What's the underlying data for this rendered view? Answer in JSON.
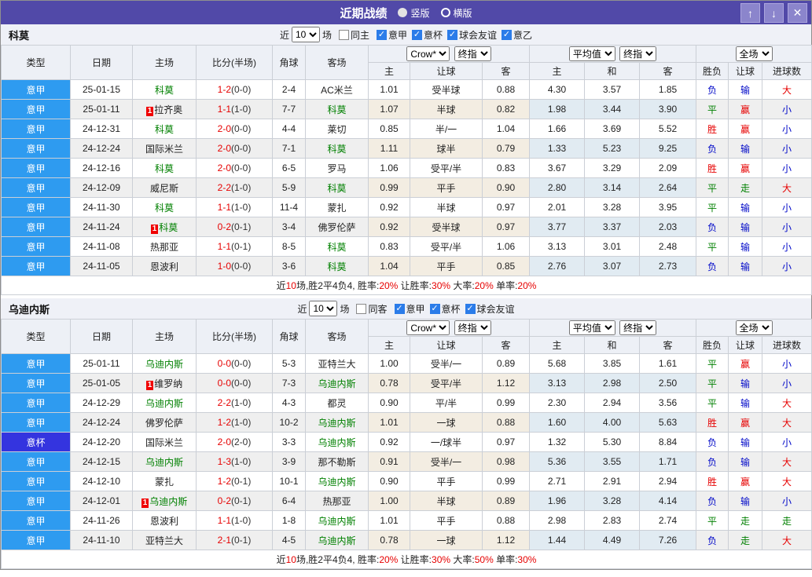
{
  "titlebar": {
    "title": "近期战绩",
    "vertical": "竖版",
    "horizontal": "横版",
    "buttons": {
      "up": "↑",
      "down": "↓",
      "close": "✕"
    }
  },
  "colors": {
    "titlebar_purple": "#5149A8",
    "league_blue": "#2E9BF0",
    "cup_blue": "#3434DF",
    "win_red": "#E60000",
    "draw_green": "#008000",
    "lose_blue": "#0008C8",
    "checkbox_blue": "#2B7CE9"
  },
  "cols": {
    "type": "类型",
    "date": "日期",
    "home": "主场",
    "score": "比分(半场)",
    "corner": "角球",
    "away": "客场",
    "h": "主",
    "hand": "让球",
    "a": "客",
    "draw": "和",
    "wl": "胜负",
    "goals": "进球数"
  },
  "selects": {
    "crow": "Crow*",
    "final": "终指",
    "avg": "平均值",
    "full": "全场"
  },
  "sections": [
    {
      "team": "科莫",
      "filter": {
        "near": "近",
        "count": "10",
        "games": "场",
        "same": "同主",
        "same_checked": false,
        "leagues": [
          [
            "意甲",
            true
          ],
          [
            "意杯",
            true
          ],
          [
            "球会友谊",
            true
          ],
          [
            "意乙",
            true
          ]
        ]
      },
      "rows": [
        {
          "lg": "意甲",
          "cup": false,
          "date": "25-01-15",
          "home": "科莫",
          "hg": true,
          "hb": false,
          "score": "1-2",
          "half": "(0-0)",
          "corner": "2-4",
          "away": "AC米兰",
          "ag": false,
          "ab": false,
          "crow": [
            "1.01",
            "受半球",
            "0.88"
          ],
          "avg": [
            "4.30",
            "3.57",
            "1.85"
          ],
          "res": [
            [
              "负",
              "b"
            ],
            [
              "输",
              "b"
            ],
            [
              "大",
              "r"
            ]
          ]
        },
        {
          "lg": "意甲",
          "cup": false,
          "date": "25-01-11",
          "home": "拉齐奥",
          "hg": false,
          "hb": true,
          "score": "1-1",
          "half": "(1-0)",
          "corner": "7-7",
          "away": "科莫",
          "ag": true,
          "ab": false,
          "crow": [
            "1.07",
            "半球",
            "0.82"
          ],
          "avg": [
            "1.98",
            "3.44",
            "3.90"
          ],
          "res": [
            [
              "平",
              "g"
            ],
            [
              "赢",
              "r"
            ],
            [
              "小",
              "b"
            ]
          ]
        },
        {
          "lg": "意甲",
          "cup": false,
          "date": "24-12-31",
          "home": "科莫",
          "hg": true,
          "hb": false,
          "score": "2-0",
          "half": "(0-0)",
          "corner": "4-4",
          "away": "莱切",
          "ag": false,
          "ab": false,
          "crow": [
            "0.85",
            "半/一",
            "1.04"
          ],
          "avg": [
            "1.66",
            "3.69",
            "5.52"
          ],
          "res": [
            [
              "胜",
              "r"
            ],
            [
              "赢",
              "r"
            ],
            [
              "小",
              "b"
            ]
          ]
        },
        {
          "lg": "意甲",
          "cup": false,
          "date": "24-12-24",
          "home": "国际米兰",
          "hg": false,
          "hb": false,
          "score": "2-0",
          "half": "(0-0)",
          "corner": "7-1",
          "away": "科莫",
          "ag": true,
          "ab": false,
          "crow": [
            "1.11",
            "球半",
            "0.79"
          ],
          "avg": [
            "1.33",
            "5.23",
            "9.25"
          ],
          "res": [
            [
              "负",
              "b"
            ],
            [
              "输",
              "b"
            ],
            [
              "小",
              "b"
            ]
          ]
        },
        {
          "lg": "意甲",
          "cup": false,
          "date": "24-12-16",
          "home": "科莫",
          "hg": true,
          "hb": false,
          "score": "2-0",
          "half": "(0-0)",
          "corner": "6-5",
          "away": "罗马",
          "ag": false,
          "ab": false,
          "crow": [
            "1.06",
            "受平/半",
            "0.83"
          ],
          "avg": [
            "3.67",
            "3.29",
            "2.09"
          ],
          "res": [
            [
              "胜",
              "r"
            ],
            [
              "赢",
              "r"
            ],
            [
              "小",
              "b"
            ]
          ]
        },
        {
          "lg": "意甲",
          "cup": false,
          "date": "24-12-09",
          "home": "威尼斯",
          "hg": false,
          "hb": false,
          "score": "2-2",
          "half": "(1-0)",
          "corner": "5-9",
          "away": "科莫",
          "ag": true,
          "ab": false,
          "crow": [
            "0.99",
            "平手",
            "0.90"
          ],
          "avg": [
            "2.80",
            "3.14",
            "2.64"
          ],
          "res": [
            [
              "平",
              "g"
            ],
            [
              "走",
              "g"
            ],
            [
              "大",
              "r"
            ]
          ]
        },
        {
          "lg": "意甲",
          "cup": false,
          "date": "24-11-30",
          "home": "科莫",
          "hg": true,
          "hb": false,
          "score": "1-1",
          "half": "(1-0)",
          "corner": "11-4",
          "away": "蒙扎",
          "ag": false,
          "ab": false,
          "crow": [
            "0.92",
            "半球",
            "0.97"
          ],
          "avg": [
            "2.01",
            "3.28",
            "3.95"
          ],
          "res": [
            [
              "平",
              "g"
            ],
            [
              "输",
              "b"
            ],
            [
              "小",
              "b"
            ]
          ]
        },
        {
          "lg": "意甲",
          "cup": false,
          "date": "24-11-24",
          "home": "科莫",
          "hg": true,
          "hb": true,
          "score": "0-2",
          "half": "(0-1)",
          "corner": "3-4",
          "away": "佛罗伦萨",
          "ag": false,
          "ab": false,
          "crow": [
            "0.92",
            "受半球",
            "0.97"
          ],
          "avg": [
            "3.77",
            "3.37",
            "2.03"
          ],
          "res": [
            [
              "负",
              "b"
            ],
            [
              "输",
              "b"
            ],
            [
              "小",
              "b"
            ]
          ]
        },
        {
          "lg": "意甲",
          "cup": false,
          "date": "24-11-08",
          "home": "热那亚",
          "hg": false,
          "hb": false,
          "score": "1-1",
          "half": "(0-1)",
          "corner": "8-5",
          "away": "科莫",
          "ag": true,
          "ab": false,
          "crow": [
            "0.83",
            "受平/半",
            "1.06"
          ],
          "avg": [
            "3.13",
            "3.01",
            "2.48"
          ],
          "res": [
            [
              "平",
              "g"
            ],
            [
              "输",
              "b"
            ],
            [
              "小",
              "b"
            ]
          ]
        },
        {
          "lg": "意甲",
          "cup": false,
          "date": "24-11-05",
          "home": "恩波利",
          "hg": false,
          "hb": false,
          "score": "1-0",
          "half": "(0-0)",
          "corner": "3-6",
          "away": "科莫",
          "ag": true,
          "ab": false,
          "crow": [
            "1.04",
            "平手",
            "0.85"
          ],
          "avg": [
            "2.76",
            "3.07",
            "2.73"
          ],
          "res": [
            [
              "负",
              "b"
            ],
            [
              "输",
              "b"
            ],
            [
              "小",
              "b"
            ]
          ]
        }
      ],
      "summary": [
        {
          "t": "近",
          "r": false
        },
        {
          "t": "10",
          "r": true
        },
        {
          "t": "场,胜2平4负4, 胜率:",
          "r": false
        },
        {
          "t": "20%",
          "r": true
        },
        {
          "t": " 让胜率:",
          "r": false
        },
        {
          "t": "30%",
          "r": true
        },
        {
          "t": " 大率:",
          "r": false
        },
        {
          "t": "20%",
          "r": true
        },
        {
          "t": " 单率:",
          "r": false
        },
        {
          "t": "20%",
          "r": true
        }
      ]
    },
    {
      "team": "乌迪内斯",
      "filter": {
        "near": "近",
        "count": "10",
        "games": "场",
        "same": "同客",
        "same_checked": false,
        "leagues": [
          [
            "意甲",
            true
          ],
          [
            "意杯",
            true
          ],
          [
            "球会友谊",
            true
          ]
        ]
      },
      "rows": [
        {
          "lg": "意甲",
          "cup": false,
          "date": "25-01-11",
          "home": "乌迪内斯",
          "hg": true,
          "hb": false,
          "score": "0-0",
          "half": "(0-0)",
          "corner": "5-3",
          "away": "亚特兰大",
          "ag": false,
          "ab": false,
          "crow": [
            "1.00",
            "受半/一",
            "0.89"
          ],
          "avg": [
            "5.68",
            "3.85",
            "1.61"
          ],
          "res": [
            [
              "平",
              "g"
            ],
            [
              "赢",
              "r"
            ],
            [
              "小",
              "b"
            ]
          ]
        },
        {
          "lg": "意甲",
          "cup": false,
          "date": "25-01-05",
          "home": "维罗纳",
          "hg": false,
          "hb": true,
          "score": "0-0",
          "half": "(0-0)",
          "corner": "7-3",
          "away": "乌迪内斯",
          "ag": true,
          "ab": false,
          "crow": [
            "0.78",
            "受平/半",
            "1.12"
          ],
          "avg": [
            "3.13",
            "2.98",
            "2.50"
          ],
          "res": [
            [
              "平",
              "g"
            ],
            [
              "输",
              "b"
            ],
            [
              "小",
              "b"
            ]
          ]
        },
        {
          "lg": "意甲",
          "cup": false,
          "date": "24-12-29",
          "home": "乌迪内斯",
          "hg": true,
          "hb": false,
          "score": "2-2",
          "half": "(1-0)",
          "corner": "4-3",
          "away": "都灵",
          "ag": false,
          "ab": false,
          "crow": [
            "0.90",
            "平/半",
            "0.99"
          ],
          "avg": [
            "2.30",
            "2.94",
            "3.56"
          ],
          "res": [
            [
              "平",
              "g"
            ],
            [
              "输",
              "b"
            ],
            [
              "大",
              "r"
            ]
          ]
        },
        {
          "lg": "意甲",
          "cup": false,
          "date": "24-12-24",
          "home": "佛罗伦萨",
          "hg": false,
          "hb": false,
          "score": "1-2",
          "half": "(1-0)",
          "corner": "10-2",
          "away": "乌迪内斯",
          "ag": true,
          "ab": false,
          "crow": [
            "1.01",
            "一球",
            "0.88"
          ],
          "avg": [
            "1.60",
            "4.00",
            "5.63"
          ],
          "res": [
            [
              "胜",
              "r"
            ],
            [
              "赢",
              "r"
            ],
            [
              "大",
              "r"
            ]
          ]
        },
        {
          "lg": "意杯",
          "cup": true,
          "date": "24-12-20",
          "home": "国际米兰",
          "hg": false,
          "hb": false,
          "score": "2-0",
          "half": "(2-0)",
          "corner": "3-3",
          "away": "乌迪内斯",
          "ag": true,
          "ab": false,
          "crow": [
            "0.92",
            "一/球半",
            "0.97"
          ],
          "avg": [
            "1.32",
            "5.30",
            "8.84"
          ],
          "res": [
            [
              "负",
              "b"
            ],
            [
              "输",
              "b"
            ],
            [
              "小",
              "b"
            ]
          ]
        },
        {
          "lg": "意甲",
          "cup": false,
          "date": "24-12-15",
          "home": "乌迪内斯",
          "hg": true,
          "hb": false,
          "score": "1-3",
          "half": "(1-0)",
          "corner": "3-9",
          "away": "那不勒斯",
          "ag": false,
          "ab": false,
          "crow": [
            "0.91",
            "受半/一",
            "0.98"
          ],
          "avg": [
            "5.36",
            "3.55",
            "1.71"
          ],
          "res": [
            [
              "负",
              "b"
            ],
            [
              "输",
              "b"
            ],
            [
              "大",
              "r"
            ]
          ]
        },
        {
          "lg": "意甲",
          "cup": false,
          "date": "24-12-10",
          "home": "蒙扎",
          "hg": false,
          "hb": false,
          "score": "1-2",
          "half": "(0-1)",
          "corner": "10-1",
          "away": "乌迪内斯",
          "ag": true,
          "ab": false,
          "crow": [
            "0.90",
            "平手",
            "0.99"
          ],
          "avg": [
            "2.71",
            "2.91",
            "2.94"
          ],
          "res": [
            [
              "胜",
              "r"
            ],
            [
              "赢",
              "r"
            ],
            [
              "大",
              "r"
            ]
          ]
        },
        {
          "lg": "意甲",
          "cup": false,
          "date": "24-12-01",
          "home": "乌迪内斯",
          "hg": true,
          "hb": true,
          "score": "0-2",
          "half": "(0-1)",
          "corner": "6-4",
          "away": "热那亚",
          "ag": false,
          "ab": false,
          "crow": [
            "1.00",
            "半球",
            "0.89"
          ],
          "avg": [
            "1.96",
            "3.28",
            "4.14"
          ],
          "res": [
            [
              "负",
              "b"
            ],
            [
              "输",
              "b"
            ],
            [
              "小",
              "b"
            ]
          ]
        },
        {
          "lg": "意甲",
          "cup": false,
          "date": "24-11-26",
          "home": "恩波利",
          "hg": false,
          "hb": false,
          "score": "1-1",
          "half": "(1-0)",
          "corner": "1-8",
          "away": "乌迪内斯",
          "ag": true,
          "ab": false,
          "crow": [
            "1.01",
            "平手",
            "0.88"
          ],
          "avg": [
            "2.98",
            "2.83",
            "2.74"
          ],
          "res": [
            [
              "平",
              "g"
            ],
            [
              "走",
              "g"
            ],
            [
              "走",
              "g"
            ]
          ]
        },
        {
          "lg": "意甲",
          "cup": false,
          "date": "24-11-10",
          "home": "亚特兰大",
          "hg": false,
          "hb": false,
          "score": "2-1",
          "half": "(0-1)",
          "corner": "4-5",
          "away": "乌迪内斯",
          "ag": true,
          "ab": false,
          "crow": [
            "0.78",
            "一球",
            "1.12"
          ],
          "avg": [
            "1.44",
            "4.49",
            "7.26"
          ],
          "res": [
            [
              "负",
              "b"
            ],
            [
              "走",
              "g"
            ],
            [
              "大",
              "r"
            ]
          ]
        }
      ],
      "summary": [
        {
          "t": "近",
          "r": false
        },
        {
          "t": "10",
          "r": true
        },
        {
          "t": "场,胜2平4负4, 胜率:",
          "r": false
        },
        {
          "t": "20%",
          "r": true
        },
        {
          "t": " 让胜率:",
          "r": false
        },
        {
          "t": "30%",
          "r": true
        },
        {
          "t": " 大率:",
          "r": false
        },
        {
          "t": "50%",
          "r": true
        },
        {
          "t": " 单率:",
          "r": false
        },
        {
          "t": "30%",
          "r": true
        }
      ]
    }
  ]
}
